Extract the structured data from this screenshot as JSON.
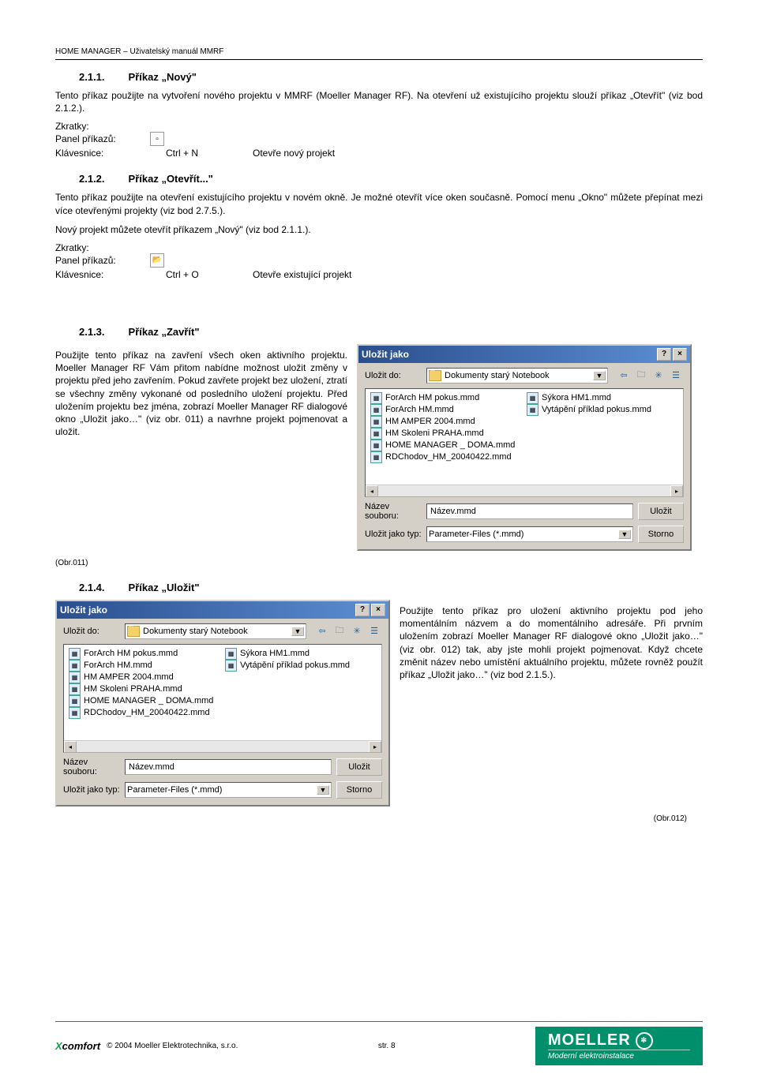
{
  "header": "HOME MANAGER – Uživatelský manuál  MMRF",
  "s211": {
    "num": "2.1.1.",
    "title": "Příkaz „Nový\"",
    "body": "Tento příkaz použijte na vytvoření nového projektu v MMRF (Moeller Manager RF). Na otevření už existujícího projektu slouží příkaz „Otevřít\" (viz bod 2.1.2.).",
    "zkratky": "Zkratky:",
    "panel": "Panel příkazů:",
    "klav": "Klávesnice:",
    "key": "Ctrl + N",
    "desc": "Otevře nový projekt"
  },
  "s212": {
    "num": "2.1.2.",
    "title": "Příkaz „Otevřít...\"",
    "body1": "Tento příkaz použijte na otevření existujícího projektu v novém okně. Je možné otevřít více oken současně. Pomocí menu „Okno\" můžete přepínat mezi více otevřenými projekty (viz bod 2.7.5.).",
    "body2": "Nový projekt můžete otevřít příkazem „Nový\" (viz bod 2.1.1.).",
    "zkratky": "Zkratky:",
    "panel": "Panel příkazů:",
    "klav": "Klávesnice:",
    "key": "Ctrl + O",
    "desc": "Otevře existující projekt"
  },
  "s213": {
    "num": "2.1.3.",
    "title": "Příkaz „Zavřít\"",
    "body": "Použijte tento příkaz na zavření všech oken aktivního projektu. Moeller Manager RF Vám přitom nabídne možnost uložit změny v projektu před jeho zavřením. Pokud zavřete projekt bez uložení, ztratí se všechny změny vykonané od posledního uložení projektu. Před uložením projektu bez jména, zobrazí Moeller Manager RF dialogové okno „Uložit jako…\" (viz obr. 011) a navrhne projekt pojmenovat a uložit.",
    "obr": "(Obr.011)"
  },
  "s214": {
    "num": "2.1.4.",
    "title": "Příkaz „Uložit\"",
    "body": "Použijte tento příkaz pro uložení aktivního projektu pod jeho momentálním názvem a do momentálního adresáře. Při prvním uložením zobrazí Moeller Manager RF dialogové okno „Uložit jako…\" (viz obr. 012) tak, aby jste mohli projekt pojmenovat. Když chcete změnit název nebo  umístění aktuálního projektu, můžete rovněž použít příkaz „Uložit jako…\" (viz bod 2.1.5.).",
    "obr": "(Obr.012)"
  },
  "dialog": {
    "title": "Uložit jako",
    "saveTo": "Uložit do:",
    "folder": "Dokumenty starý Notebook",
    "files_left": [
      "ForArch HM pokus.mmd",
      "ForArch HM.mmd",
      "HM AMPER 2004.mmd",
      "HM Skoleni PRAHA.mmd",
      "HOME MANAGER _ DOMA.mmd",
      "RDChodov_HM_20040422.mmd"
    ],
    "files_right": [
      "Sýkora HM1.mmd",
      "Vytápění příklad pokus.mmd"
    ],
    "lbl_name_1": "Název",
    "lbl_name_2": "souboru:",
    "filename": "Název.mmd",
    "lbl_type": "Uložit jako typ:",
    "filetype": "Parameter-Files (*.mmd)",
    "btn_save": "Uložit",
    "btn_cancel": "Storno"
  },
  "footer": {
    "brand1": "X",
    "brand2": "comfort",
    "copyright": "© 2004 Moeller Elektrotechnika, s.r.o.",
    "page": "str. 8",
    "moeller": "MOELLER",
    "sub": "Moderní elektroinstalace"
  }
}
